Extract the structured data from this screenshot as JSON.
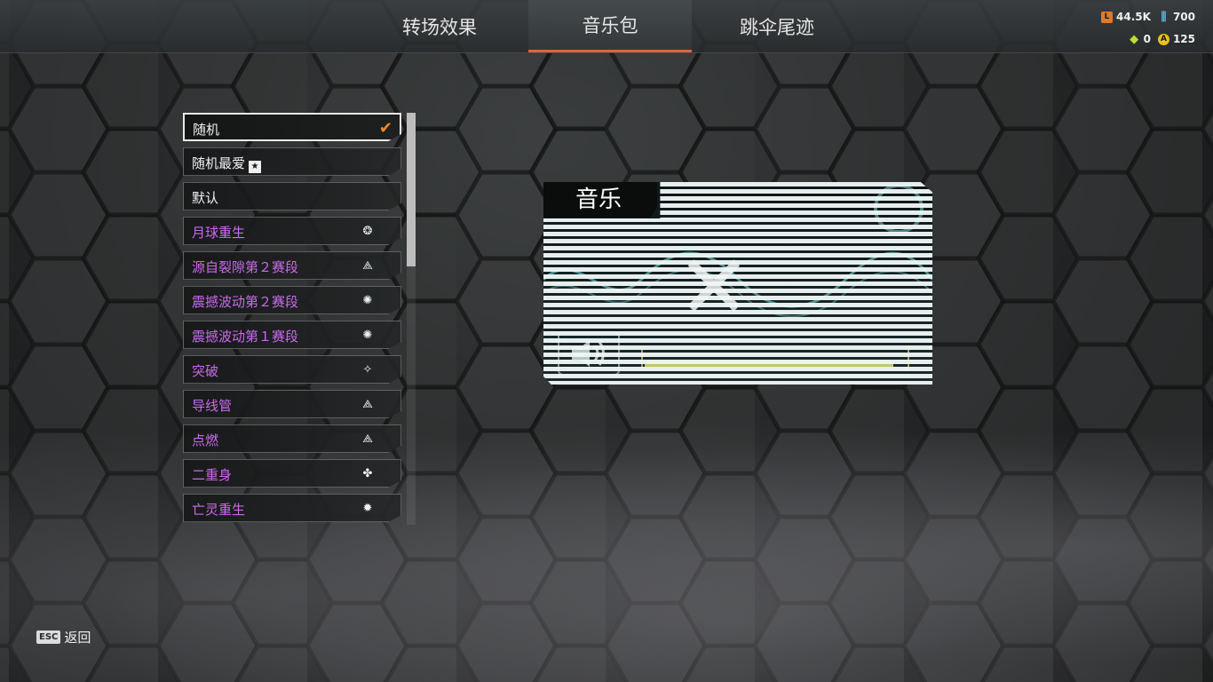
{
  "tabs": [
    {
      "label": "转场效果"
    },
    {
      "label": "音乐包"
    },
    {
      "label": "跳伞尾迹"
    }
  ],
  "currency": {
    "legend_tokens": "44.5K",
    "crafting_metals": "700",
    "exotic_shards": "0",
    "apex_coins": "125"
  },
  "list": {
    "items": [
      {
        "label": "随机",
        "icon": "checkmark-icon",
        "selected": true
      },
      {
        "label": "随机最爱",
        "icon": "favorite-icon"
      },
      {
        "label": "默认",
        "icon": ""
      },
      {
        "label": "月球重生",
        "icon": "legend-emblem-icon"
      },
      {
        "label": "源自裂隙第２赛段",
        "icon": "legend-emblem-icon"
      },
      {
        "label": "震撼波动第２赛段",
        "icon": "legend-emblem-icon"
      },
      {
        "label": "震撼波动第１赛段",
        "icon": "legend-emblem-icon"
      },
      {
        "label": "突破",
        "icon": "legend-emblem-icon"
      },
      {
        "label": "导线管",
        "icon": "legend-emblem-icon"
      },
      {
        "label": "点燃",
        "icon": "legend-emblem-icon"
      },
      {
        "label": "二重身",
        "icon": "legend-emblem-icon"
      },
      {
        "label": "亡灵重生",
        "icon": "legend-emblem-icon"
      }
    ]
  },
  "preview": {
    "title": "音乐"
  },
  "footer": {
    "esc_key": "ESC",
    "back_label": "返回"
  },
  "colors": {
    "accent": "#e0633a",
    "check": "#f08a2a",
    "rare_text": "#c86bec"
  }
}
